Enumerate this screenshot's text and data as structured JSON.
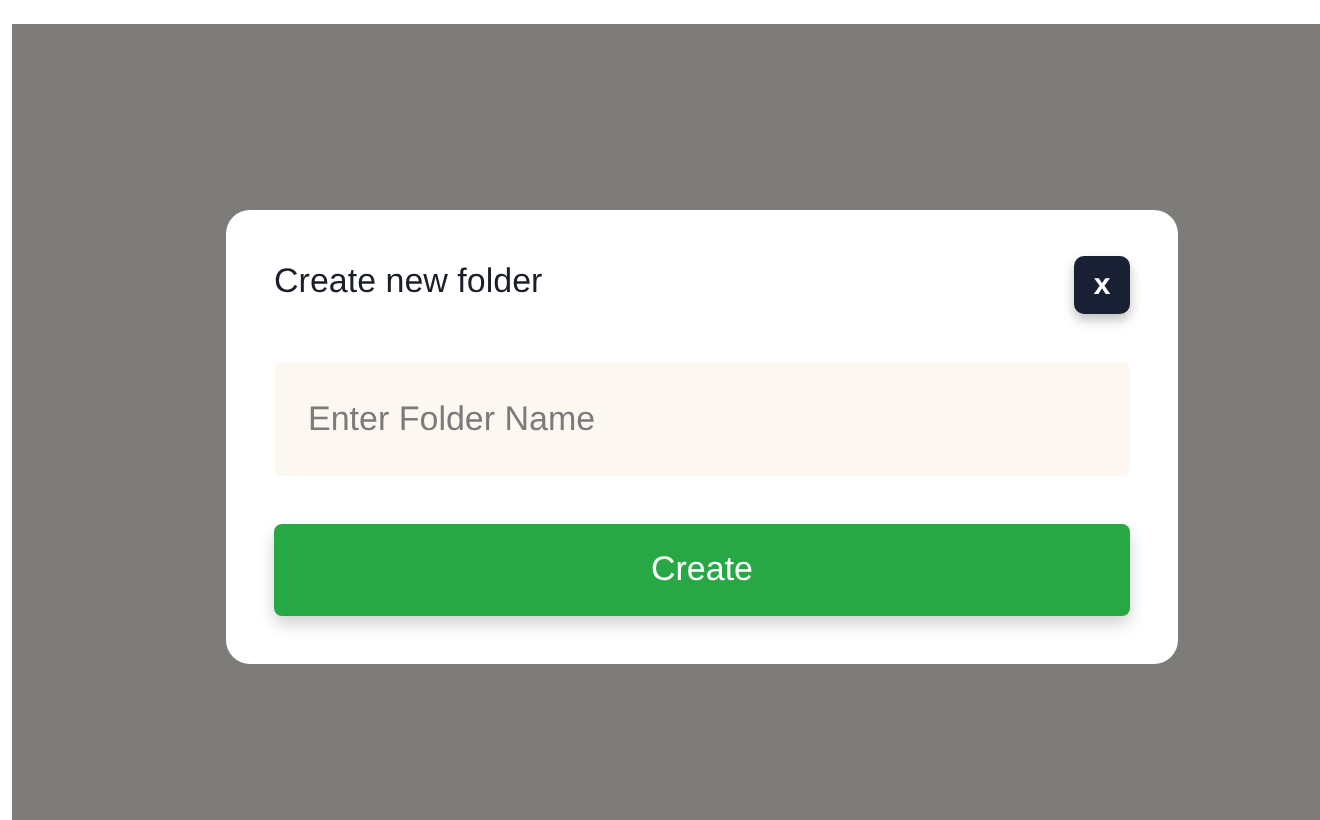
{
  "dialog": {
    "title": "Create new folder",
    "close_label": "x",
    "field": {
      "placeholder": "Enter Folder Name"
    },
    "button": "Create"
  }
}
